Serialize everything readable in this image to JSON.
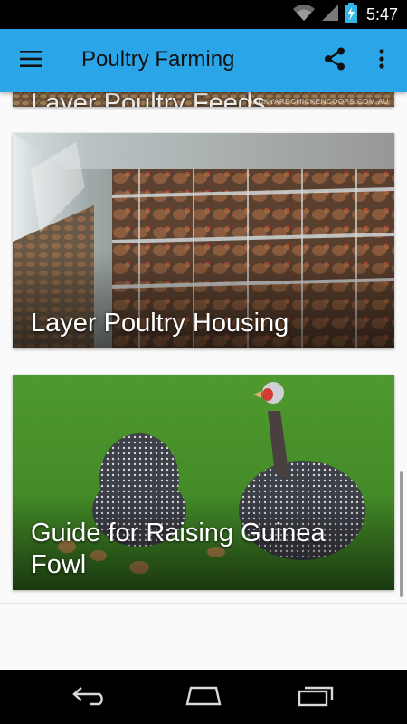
{
  "status_bar": {
    "time": "5:47",
    "icons": [
      "wifi-icon",
      "signal-icon",
      "battery-charging-icon"
    ]
  },
  "app_bar": {
    "title": "Poultry Farming",
    "icons": [
      "menu-icon",
      "share-icon",
      "more-vert-icon"
    ],
    "color": "#2aa5e8"
  },
  "cards": [
    {
      "title": "Layer Poultry Feeds",
      "watermark": "BACKYARDCHICKENCOOPS.COM.AU"
    },
    {
      "title": "Layer Poultry Housing"
    },
    {
      "title": "Guide for Raising Guinea Fowl"
    }
  ],
  "nav_bar": {
    "icons": [
      "back-icon",
      "home-icon",
      "recents-icon"
    ]
  }
}
